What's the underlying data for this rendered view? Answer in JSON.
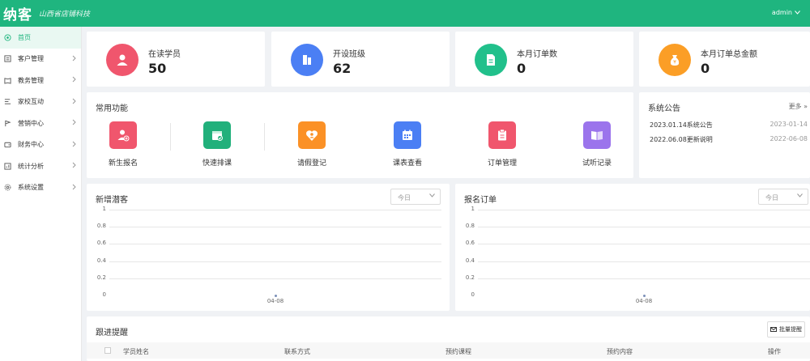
{
  "header": {
    "logo": "纳客",
    "slogan": "山西省店铺科技",
    "user": "admin"
  },
  "sidebar": {
    "items": [
      {
        "label": "首页",
        "icon": "home-icon",
        "active": true
      },
      {
        "label": "客户管理",
        "icon": "user-group-icon"
      },
      {
        "label": "教务管理",
        "icon": "book-icon"
      },
      {
        "label": "家校互动",
        "icon": "chat-icon"
      },
      {
        "label": "营销中心",
        "icon": "flag-icon"
      },
      {
        "label": "财务中心",
        "icon": "wallet-icon"
      },
      {
        "label": "统计分析",
        "icon": "chart-icon"
      },
      {
        "label": "系统设置",
        "icon": "gear-icon"
      }
    ]
  },
  "stats": [
    {
      "label": "在读学员",
      "value": "50",
      "color": "#f0566d"
    },
    {
      "label": "开设班级",
      "value": "62",
      "color": "#4b7ff4"
    },
    {
      "label": "本月订单数",
      "value": "0",
      "color": "#21c08b"
    },
    {
      "label": "本月订单总金额",
      "value": "0",
      "color": "#fb9e26"
    }
  ],
  "common_functions": {
    "title": "常用功能",
    "items": [
      {
        "label": "新生报名",
        "color": "#f0566d"
      },
      {
        "label": "快速排课",
        "color": "#21b07b"
      },
      {
        "label": "请假登记",
        "color": "#fb9126"
      },
      {
        "label": "课表查看",
        "color": "#4b7ff4"
      },
      {
        "label": "订单管理",
        "color": "#f0566d"
      },
      {
        "label": "试听记录",
        "color": "#9b74ec"
      }
    ]
  },
  "notices": {
    "title": "系统公告",
    "more": "更多 »",
    "items": [
      {
        "text": "2023.01.14系统公告",
        "date": "2023-01-14"
      },
      {
        "text": "2022.06.08更新说明",
        "date": "2022-06-08"
      }
    ]
  },
  "panels": [
    {
      "title": "新增潜客",
      "select": "今日"
    },
    {
      "title": "报名订单",
      "select": "今日"
    }
  ],
  "chart_data": [
    {
      "type": "scatter",
      "x": [
        "04-08"
      ],
      "y": [
        0
      ],
      "ylim": [
        0,
        1
      ],
      "yticks": [
        "1",
        "0.8",
        "0.6",
        "0.4",
        "0.2",
        "0"
      ],
      "grid": true
    },
    {
      "type": "scatter",
      "x": [
        "04-08"
      ],
      "y": [
        0
      ],
      "ylim": [
        0,
        1
      ],
      "yticks": [
        "1",
        "0.8",
        "0.6",
        "0.4",
        "0.2",
        "0"
      ],
      "grid": true
    }
  ],
  "follow_up": {
    "title": "跟进提醒",
    "button": "批量提醒",
    "columns": [
      "学员姓名",
      "联系方式",
      "预约课程",
      "预约内容",
      "操作"
    ]
  }
}
